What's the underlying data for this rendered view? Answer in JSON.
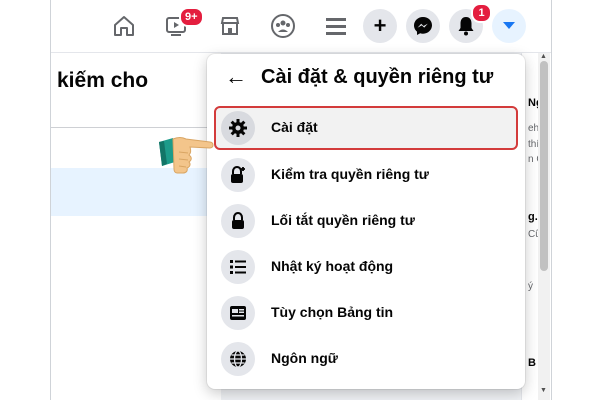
{
  "topbar": {
    "icons": [
      "home-icon",
      "watch-icon",
      "marketplace-icon",
      "groups-icon",
      "menu-icon"
    ],
    "watch_badge": "9+",
    "buttons": [
      "plus-icon",
      "messenger-icon",
      "bell-icon",
      "caret-down-icon"
    ],
    "notifications_badge": "1"
  },
  "left_panel": {
    "title": "kiếm cho"
  },
  "dropdown": {
    "title": "Cài đặt & quyền riêng tư",
    "items": [
      {
        "label": "Cài đặt",
        "icon": "gear-icon"
      },
      {
        "label": "Kiểm tra quyền riêng tư",
        "icon": "lock-plus-icon"
      },
      {
        "label": "Lối tắt quyền riêng tư",
        "icon": "lock-icon"
      },
      {
        "label": "Nhật ký hoạt động",
        "icon": "list-icon"
      },
      {
        "label": "Tùy chọn Bảng tin",
        "icon": "news-feed-icon"
      },
      {
        "label": "Ngôn ngữ",
        "icon": "globe-icon"
      }
    ]
  },
  "right_strip": {
    "snippets": [
      "Ng",
      "eh",
      "thí",
      "n C",
      "g.c",
      "Cũ",
      "ý",
      "B"
    ]
  },
  "colors": {
    "accent": "#1877f2",
    "highlight_border": "#d33b3b",
    "badge": "#e41e3f"
  }
}
